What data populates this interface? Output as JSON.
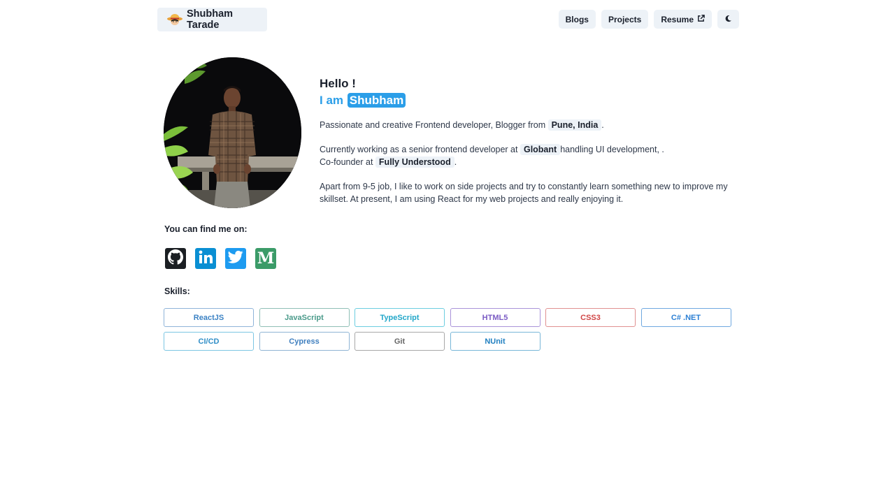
{
  "header": {
    "brand_name": "Shubham Tarade",
    "brand_icon": "straw-hat-avatar-icon",
    "nav": [
      {
        "label": "Blogs"
      },
      {
        "label": "Projects"
      },
      {
        "label": "Resume",
        "icon": "external-link-icon"
      }
    ],
    "theme_toggle_icon": "moon-icon"
  },
  "intro": {
    "greeting": "Hello !",
    "iam_prefix": "I am",
    "iam_name": "Shubham",
    "p1_text": "Passionate and creative Frontend developer, Blogger from",
    "p1_location": "Pune, India",
    "p1_end": ".",
    "p2_text": "Currently working as a senior frontend developer at",
    "p2_company": "Globant",
    "p2_rest": "handling UI development, .",
    "p2_cofounder_text": "Co-founder at",
    "p2_cofounder_company": "Fully Understood",
    "p2_end": ".",
    "p3_text": "Apart from 9-5 job, I like to work on side projects and try to constantly learn something new to improve my skillset. At present, I am using React for my web projects and really enjoying it."
  },
  "social": {
    "label": "You can find me on:",
    "links": [
      {
        "name": "GitHub",
        "icon": "github-icon"
      },
      {
        "name": "LinkedIn",
        "icon": "linkedin-icon"
      },
      {
        "name": "Twitter",
        "icon": "twitter-icon"
      },
      {
        "name": "Medium",
        "icon": "medium-icon"
      }
    ]
  },
  "skills": {
    "label": "Skills:",
    "items": [
      {
        "label": "ReactJS",
        "color": "#3b82c4",
        "border": "#8fb4d9"
      },
      {
        "label": "JavaScript",
        "color": "#4a9a8a",
        "border": "#8fbfb6"
      },
      {
        "label": "TypeScript",
        "color": "#22a7c9",
        "border": "#6ccde0"
      },
      {
        "label": "HTML5",
        "color": "#7b5cc4",
        "border": "#a993d9"
      },
      {
        "label": "CSS3",
        "color": "#d04545",
        "border": "#e09090"
      },
      {
        "label": "C# .NET",
        "color": "#2b7fd4",
        "border": "#6fa8e0"
      },
      {
        "label": "CI/CD",
        "color": "#2f8ec7",
        "border": "#7cc6e3"
      },
      {
        "label": "Cypress",
        "color": "#3f7fbf",
        "border": "#8fb4d4"
      },
      {
        "label": "Git",
        "color": "#666666",
        "border": "#a8a8a8"
      },
      {
        "label": "NUnit",
        "color": "#1f7fc0",
        "border": "#78b6d8"
      }
    ]
  }
}
